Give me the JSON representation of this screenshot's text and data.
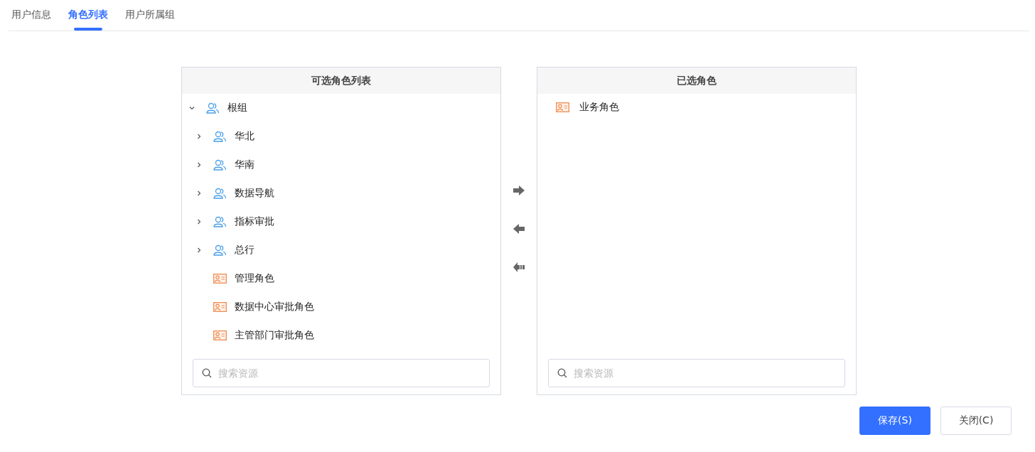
{
  "tabs": [
    {
      "label": "用户信息",
      "selected": false
    },
    {
      "label": "角色列表",
      "selected": true
    },
    {
      "label": "用户所属组",
      "selected": false
    }
  ],
  "available_panel": {
    "title": "可选角色列表",
    "tree": [
      {
        "kind": "group",
        "label": "根组",
        "expanded": true,
        "children": [
          {
            "kind": "group",
            "label": "华北",
            "expanded": false
          },
          {
            "kind": "group",
            "label": "华南",
            "expanded": false
          },
          {
            "kind": "group",
            "label": "数据导航",
            "expanded": false
          },
          {
            "kind": "group",
            "label": "指标审批",
            "expanded": false
          },
          {
            "kind": "group",
            "label": "总行",
            "expanded": false
          },
          {
            "kind": "role",
            "label": "管理角色"
          },
          {
            "kind": "role",
            "label": "数据中心审批角色"
          },
          {
            "kind": "role",
            "label": "主管部门审批角色"
          }
        ]
      }
    ],
    "search": {
      "placeholder": "搜索资源"
    }
  },
  "selected_panel": {
    "title": "已选角色",
    "items": [
      {
        "kind": "role",
        "label": "业务角色"
      }
    ],
    "search": {
      "placeholder": "搜索资源"
    }
  },
  "buttons": [
    {
      "label": "保存(S)",
      "kind": "primary"
    },
    {
      "label": "关闭(C)",
      "kind": "default"
    }
  ]
}
